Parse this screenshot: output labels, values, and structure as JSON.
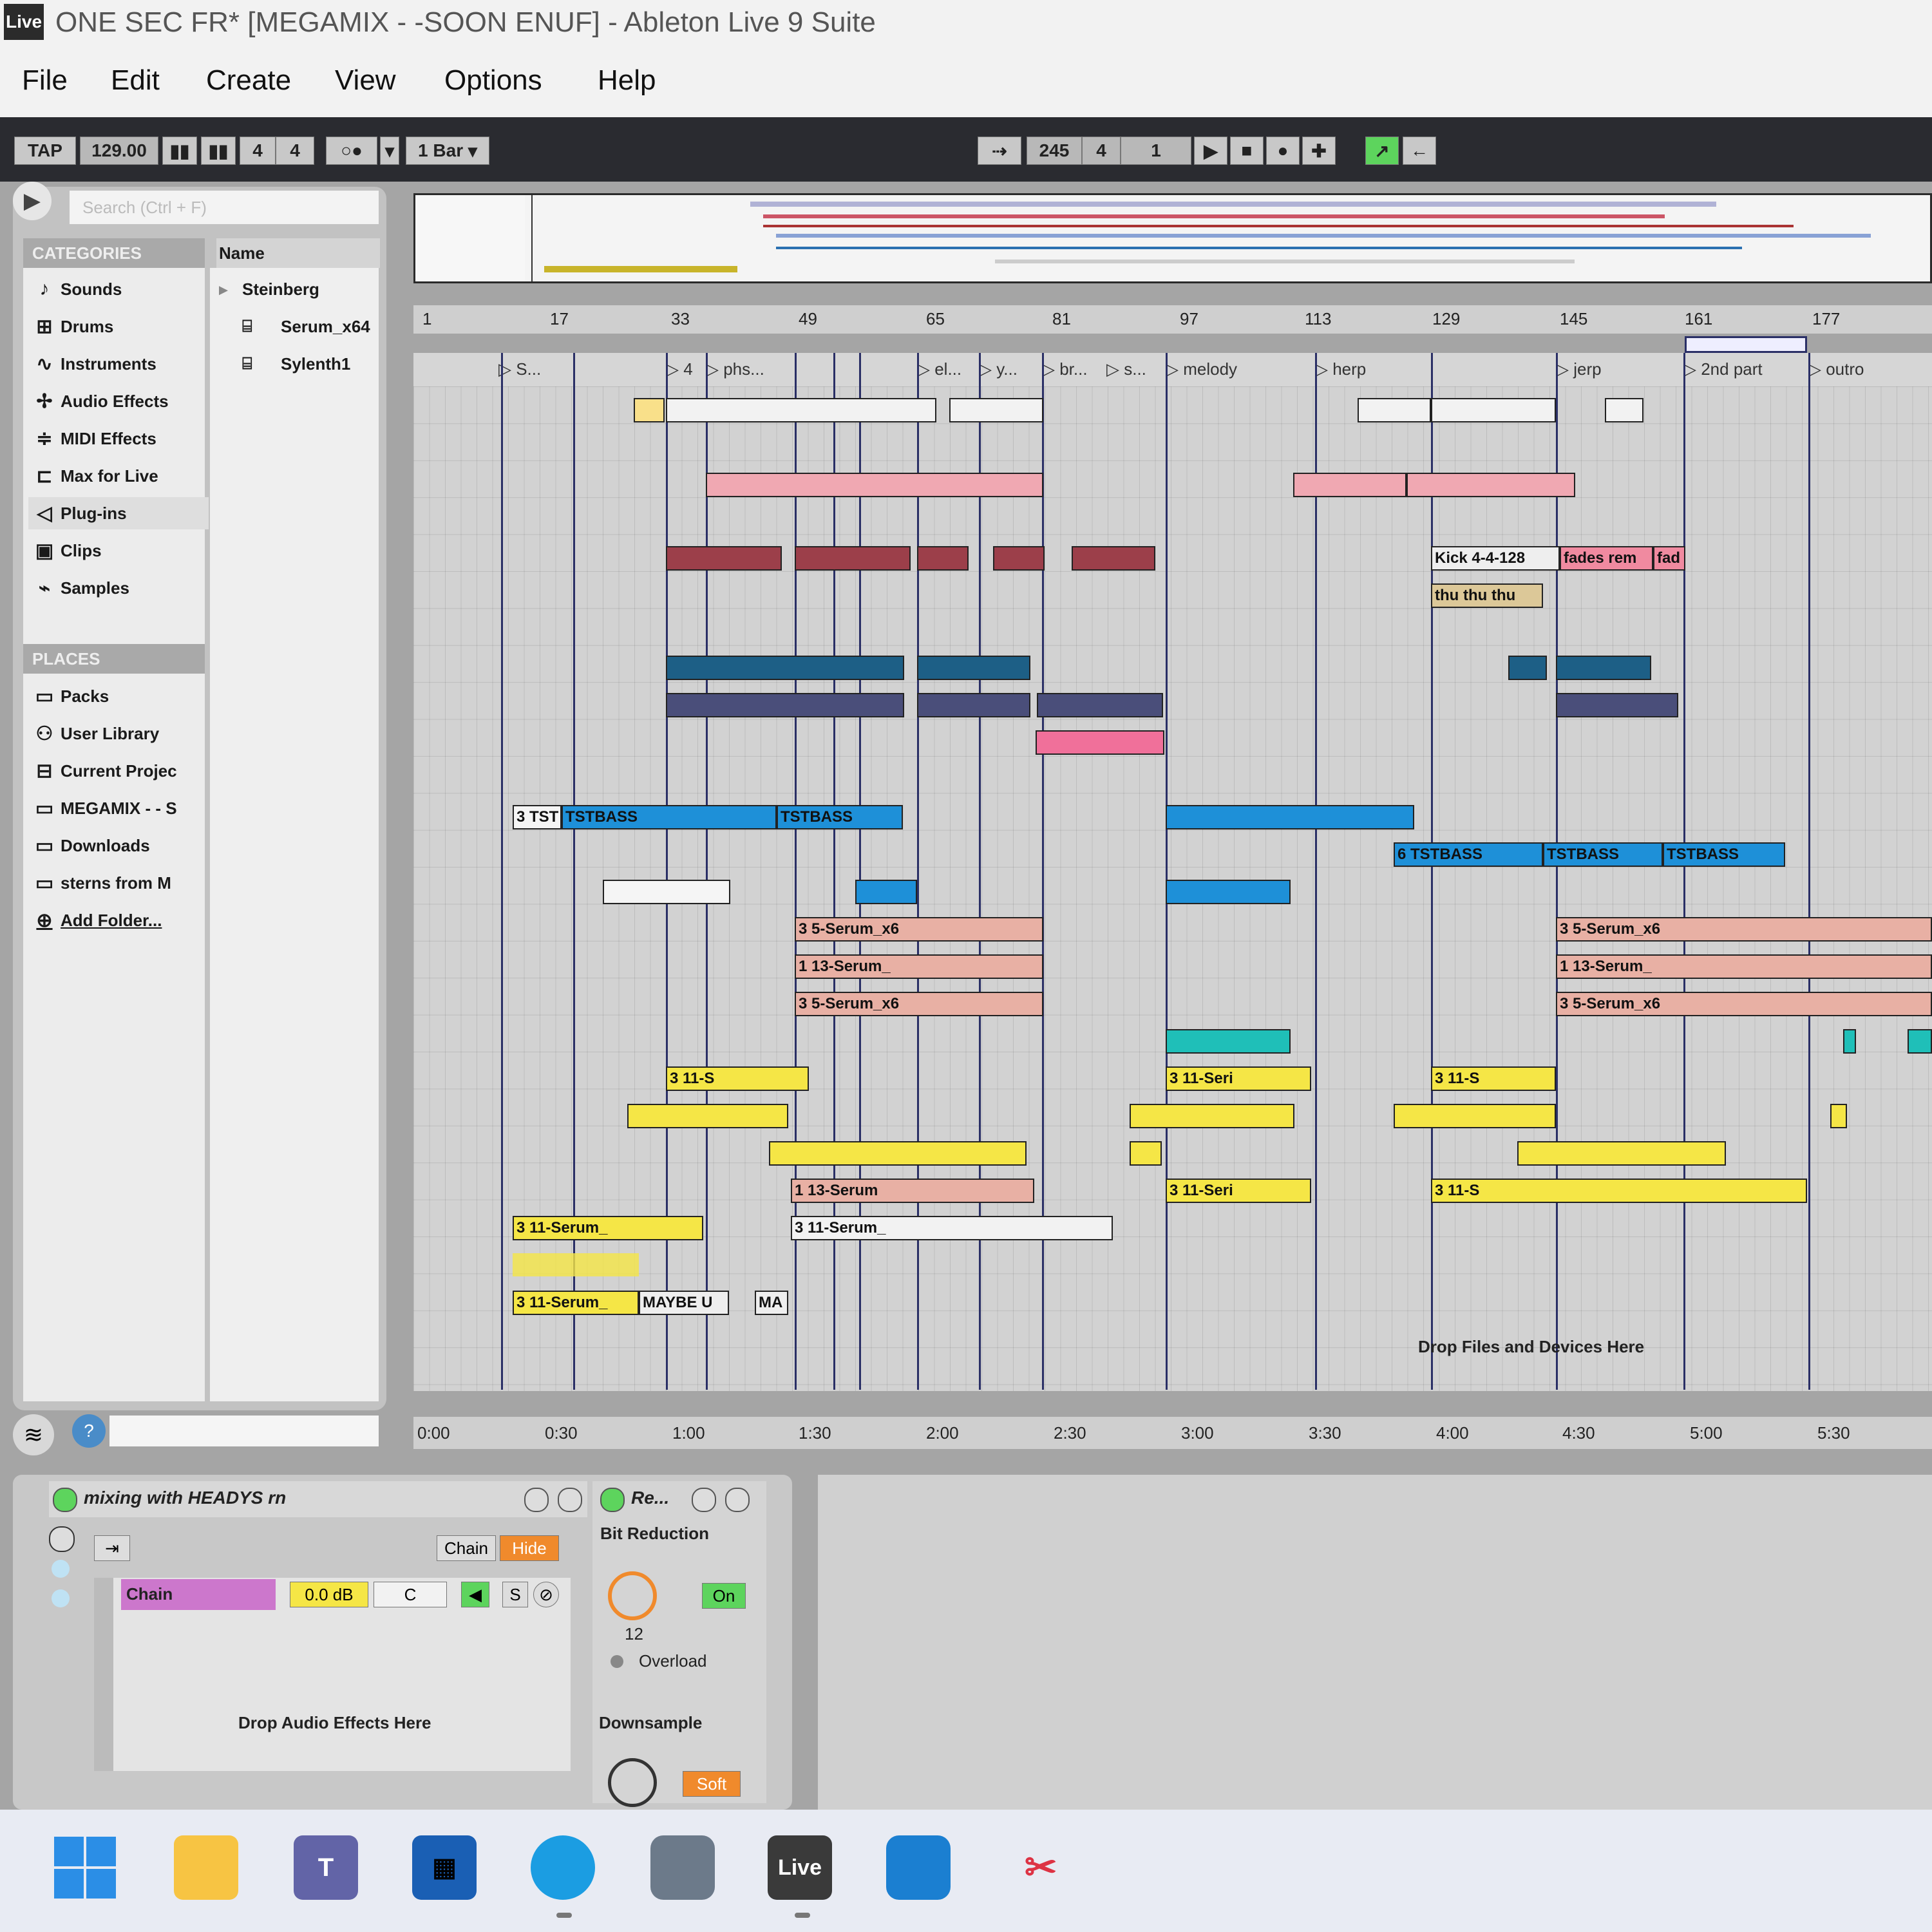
{
  "window": {
    "app_badge": "Live",
    "title": "ONE SEC FR*  [MEGAMIX - -SOON ENUF] - Ableton Live 9 Suite"
  },
  "menu": [
    "File",
    "Edit",
    "Create",
    "View",
    "Options",
    "Help"
  ],
  "transport": {
    "tap": "TAP",
    "tempo": "129.00",
    "signature_num": "4",
    "signature_den": "4",
    "quantize": "1 Bar",
    "position_bar": "245",
    "position_beat": "4",
    "position_sixteenth": "1"
  },
  "browser": {
    "search_placeholder": "Search (Ctrl + F)",
    "categories_header": "CATEGORIES",
    "categories": [
      "Sounds",
      "Drums",
      "Instruments",
      "Audio Effects",
      "MIDI Effects",
      "Max for Live",
      "Plug-ins",
      "Clips",
      "Samples"
    ],
    "places_header": "PLACES",
    "places": [
      "Packs",
      "User Library",
      "Current Projec",
      "MEGAMIX - - S",
      "Downloads",
      "sterns from M",
      "Add Folder..."
    ],
    "name_header": "Name",
    "names": [
      "Steinberg",
      "Serum_x64",
      "Sylenth1"
    ]
  },
  "arrangement": {
    "bar_ticks": [
      "1",
      "17",
      "33",
      "49",
      "65",
      "81",
      "97",
      "113",
      "129",
      "145",
      "161",
      "177"
    ],
    "locators": [
      "S...",
      "4",
      "phs...",
      "el...",
      "y...",
      "br...",
      "s...",
      "melody",
      "herp",
      "jerp",
      "2nd part",
      "outro"
    ],
    "time_ticks": [
      "0:00",
      "0:30",
      "1:00",
      "1:30",
      "2:00",
      "2:30",
      "3:00",
      "3:30",
      "4:00",
      "4:30",
      "5:00",
      "5:30"
    ],
    "drop_hint": "Drop Files and Devices Here",
    "clip_labels": {
      "tstbass_a": "3 TST",
      "tstbass_b": "TSTBASS",
      "tstbass_c": "TSTBASS",
      "tstbass_d": "6 TSTBASS",
      "tstbass_e": "TSTBASS",
      "tstbass_f": "TSTBASS",
      "serum5": "3 5-Serum_x6",
      "serum13": "1 13-Serum_",
      "serum11a": "3 11-S",
      "serum11b": "3 11-Serum_",
      "serum11c": "3 11-Seri",
      "kick": "Kick 4-4-128",
      "fades": "fades rem",
      "fad": "fad",
      "thu": "thu thu thu",
      "maybe": "MAYBE U",
      "ma": "MA",
      "serum13r": "1 13-Serum"
    }
  },
  "device_chain": {
    "rack_title": "mixing with HEADYS rn",
    "chain_btn": "Chain",
    "hide_btn": "Hide",
    "chain_name": "Chain",
    "chain_gain": "0.0 dB",
    "chain_pan": "C",
    "solo": "S",
    "drop_hint": "Drop Audio Effects Here",
    "device_title": "Re...",
    "bit_reduction": "Bit Reduction",
    "on_btn": "On",
    "bits_value": "12",
    "overload": "Overload",
    "downsample": "Downsample",
    "soft_btn": "Soft"
  },
  "taskbar": {
    "live_icon": "Live"
  },
  "colors": {
    "yellow_clip": "#f5e646",
    "blue_clip": "#1e90d8",
    "salmon_clip": "#e8b0a4",
    "pink_clip": "#f08aa0",
    "teal_clip": "#1fbfb8",
    "locator_line": "#2a2f66",
    "on_green": "#5dd45d",
    "orange_btn": "#f08a2c"
  }
}
